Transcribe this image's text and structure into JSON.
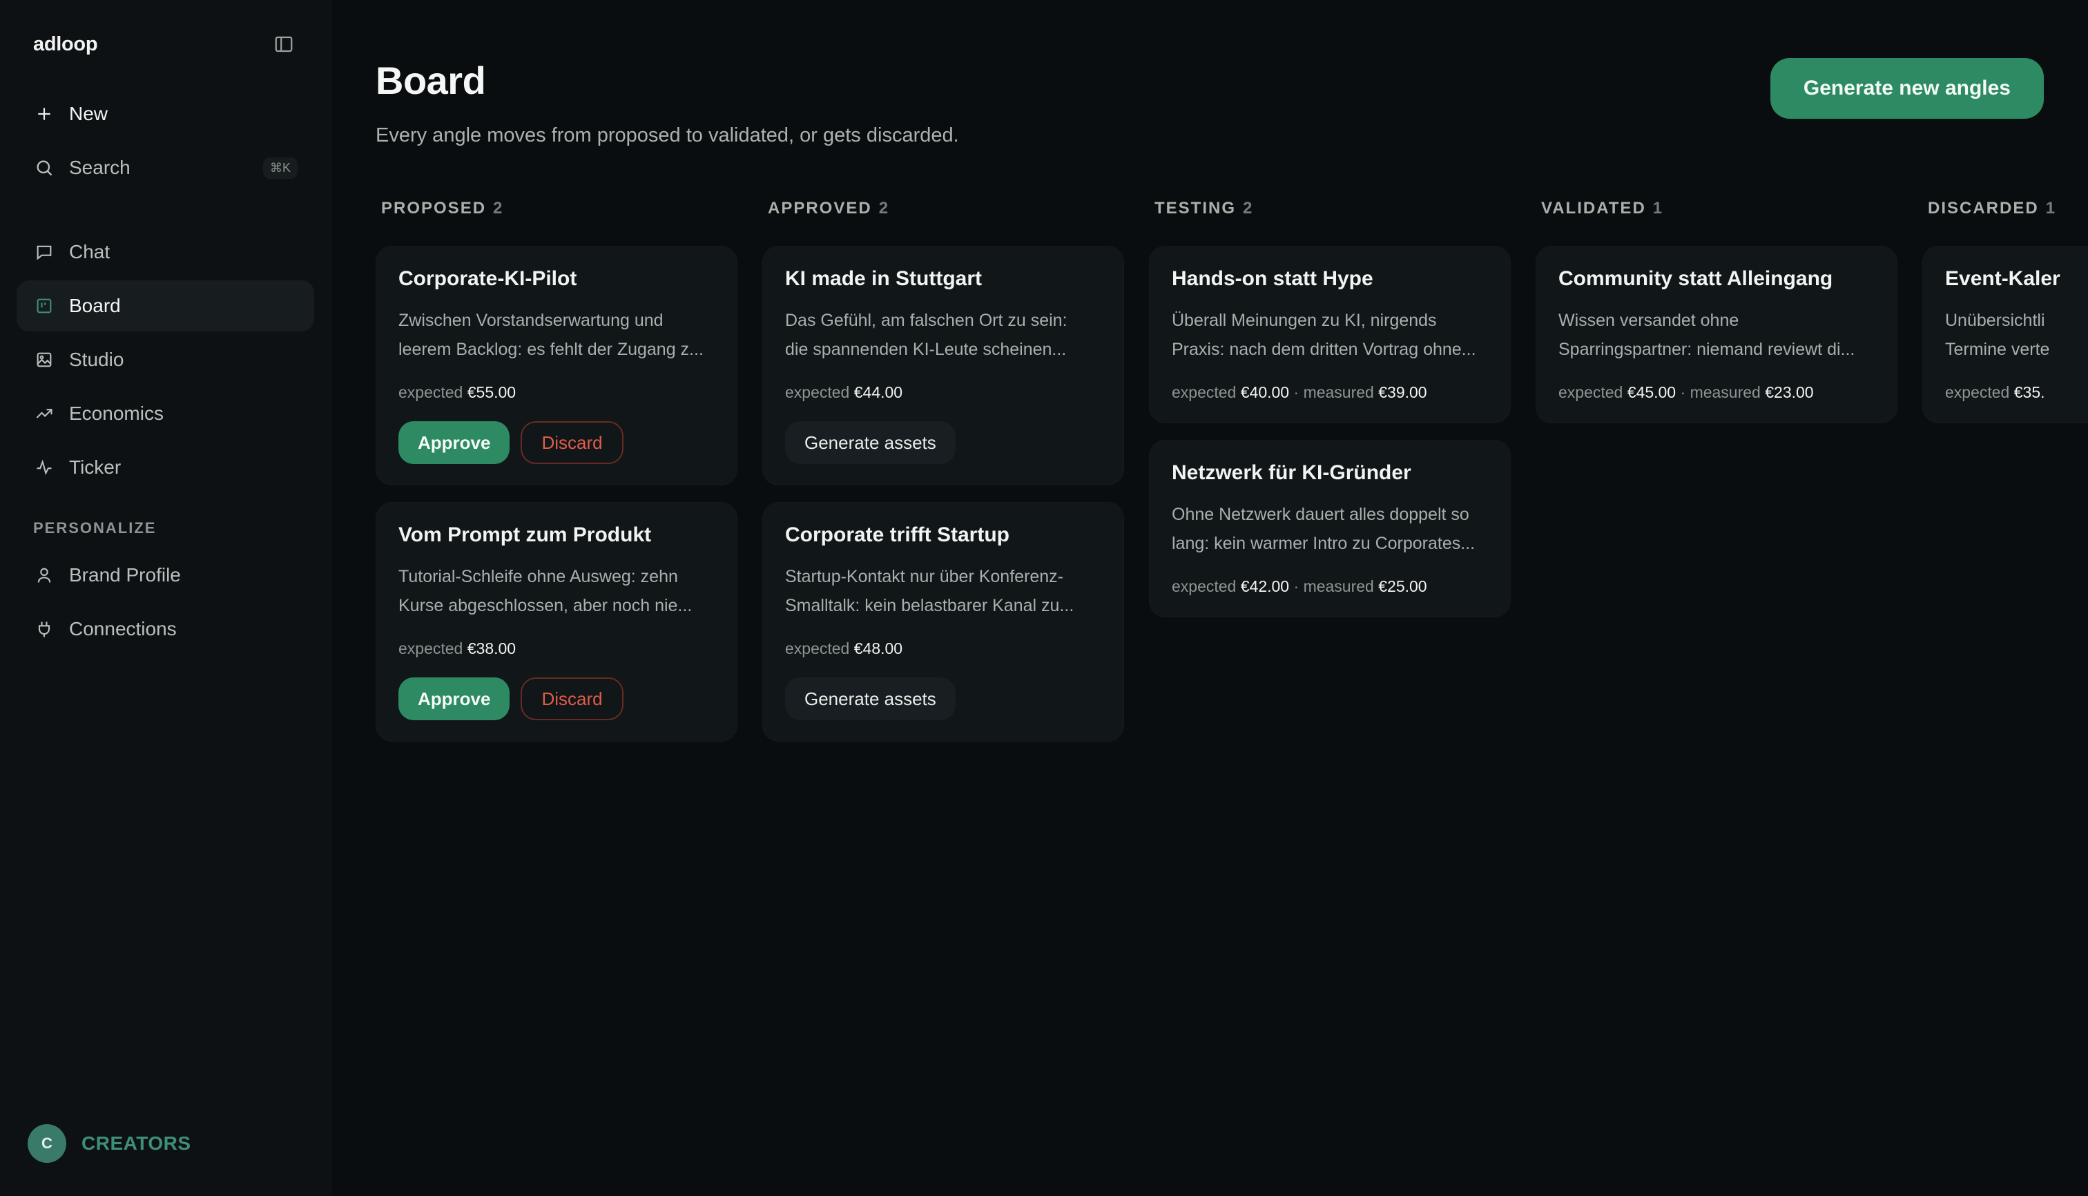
{
  "app": {
    "brand": "adloop"
  },
  "sidebar": {
    "new_label": "New",
    "search_label": "Search",
    "search_shortcut": "⌘K",
    "nav": [
      {
        "label": "Chat",
        "icon": "chat-icon"
      },
      {
        "label": "Board",
        "icon": "board-icon",
        "active": true
      },
      {
        "label": "Studio",
        "icon": "image-icon"
      },
      {
        "label": "Economics",
        "icon": "trend-icon"
      },
      {
        "label": "Ticker",
        "icon": "pulse-icon"
      }
    ],
    "section_personalize": "PERSONALIZE",
    "personalize": [
      {
        "label": "Brand Profile",
        "icon": "user-icon"
      },
      {
        "label": "Connections",
        "icon": "plug-icon"
      }
    ],
    "user": {
      "initial": "C",
      "name": "CREATORS"
    }
  },
  "header": {
    "title": "Board",
    "subtitle": "Every angle moves from proposed to validated, or gets discarded.",
    "primary_action": "Generate new angles"
  },
  "labels": {
    "expected": "expected",
    "measured": "measured",
    "approve": "Approve",
    "discard": "Discard",
    "generate_assets": "Generate assets"
  },
  "columns": [
    {
      "name": "PROPOSED",
      "count": "2",
      "cards": [
        {
          "title": "Corporate-KI-Pilot",
          "desc1": "Zwischen Vorstandserwartung und",
          "desc2": "leerem Backlog: es fehlt der Zugang z...",
          "expected": "€55.00"
        },
        {
          "title": "Vom Prompt zum Produkt",
          "desc1": "Tutorial-Schleife ohne Ausweg: zehn",
          "desc2": "Kurse abgeschlossen, aber noch nie...",
          "expected": "€38.00"
        }
      ]
    },
    {
      "name": "APPROVED",
      "count": "2",
      "cards": [
        {
          "title": "KI made in Stuttgart",
          "desc1": "Das Gefühl, am falschen Ort zu sein:",
          "desc2": "die spannenden KI-Leute scheinen...",
          "expected": "€44.00"
        },
        {
          "title": "Corporate trifft Startup",
          "desc1": "Startup-Kontakt nur über Konferenz-",
          "desc2": "Smalltalk: kein belastbarer Kanal zu...",
          "expected": "€48.00"
        }
      ]
    },
    {
      "name": "TESTING",
      "count": "2",
      "cards": [
        {
          "title": "Hands-on statt Hype",
          "desc1": "Überall Meinungen zu KI, nirgends",
          "desc2": "Praxis: nach dem dritten Vortrag ohne...",
          "expected": "€40.00",
          "measured": "€39.00"
        },
        {
          "title": "Netzwerk für KI-Gründer",
          "desc1": "Ohne Netzwerk dauert alles doppelt so",
          "desc2": "lang: kein warmer Intro zu Corporates...",
          "expected": "€42.00",
          "measured": "€25.00"
        }
      ]
    },
    {
      "name": "VALIDATED",
      "count": "1",
      "cards": [
        {
          "title": "Community statt Alleingang",
          "desc1": "Wissen versandet ohne",
          "desc2": "Sparringspartner: niemand reviewt di...",
          "expected": "€45.00",
          "measured": "€23.00"
        }
      ]
    },
    {
      "name": "DISCARDED",
      "count": "1",
      "cards": [
        {
          "title": "Event-Kaler",
          "desc1": "Unübersichtli",
          "desc2": "Termine verte",
          "expected": "€35."
        }
      ]
    }
  ]
}
